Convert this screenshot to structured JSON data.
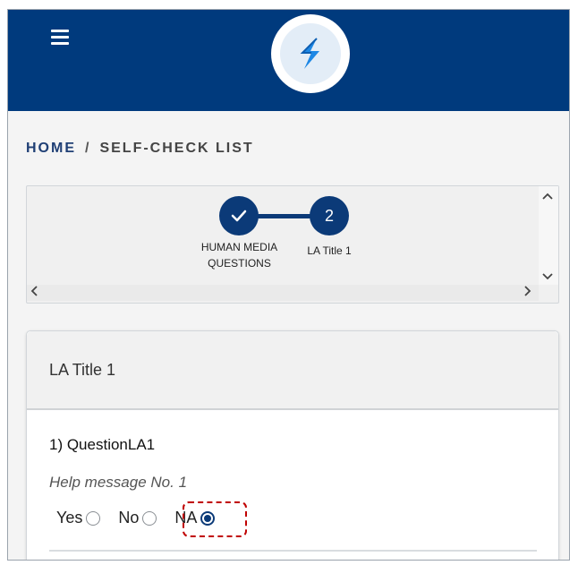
{
  "header": {
    "menu_icon": "hamburger-icon",
    "logo_icon": "app-logo",
    "logo_color": "#1e88e5",
    "bar_color": "#003a7d"
  },
  "breadcrumb": {
    "home": "HOME",
    "separator": "/",
    "current": "SELF-CHECK LIST"
  },
  "stepper": {
    "steps": [
      {
        "marker": "✓",
        "label_line1": "HUMAN MEDIA",
        "label_line2": "QUESTIONS",
        "status": "completed"
      },
      {
        "marker": "2",
        "label_line1": "LA Title 1",
        "status": "current"
      }
    ]
  },
  "section": {
    "title": "LA Title 1",
    "question": "1) QuestionLA1",
    "help": "Help message No. 1",
    "options": [
      {
        "label": "Yes",
        "checked": false
      },
      {
        "label": "No",
        "checked": false
      },
      {
        "label": "NA",
        "checked": true
      }
    ]
  }
}
